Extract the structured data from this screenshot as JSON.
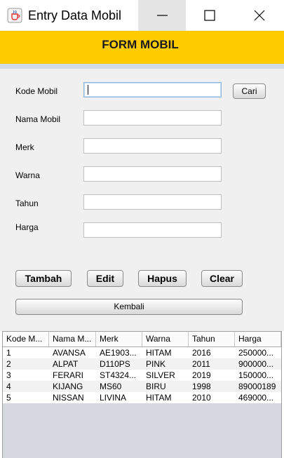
{
  "window": {
    "title": "Entry Data Mobil",
    "controls": {
      "minimize_icon": "minimize-icon",
      "maximize_icon": "maximize-icon",
      "close_icon": "close-icon"
    }
  },
  "banner": {
    "title": "FORM MOBIL",
    "color": "#ffcc00"
  },
  "form": {
    "fields": [
      {
        "label": "Kode Mobil",
        "value": ""
      },
      {
        "label": "Nama Mobil",
        "value": ""
      },
      {
        "label": "Merk",
        "value": ""
      },
      {
        "label": "Warna",
        "value": ""
      },
      {
        "label": "Tahun",
        "value": ""
      },
      {
        "label": "Harga",
        "value": ""
      }
    ],
    "search_button": "Cari"
  },
  "actions": {
    "tambah": "Tambah",
    "edit": "Edit",
    "hapus": "Hapus",
    "clear": "Clear",
    "kembali": "Kembali"
  },
  "table": {
    "columns": [
      "Kode M...",
      "Nama M...",
      "Merk",
      "Warna",
      "Tahun",
      "Harga"
    ],
    "rows": [
      [
        "1",
        "AVANSA",
        "AE1903...",
        "HITAM",
        "2016",
        "250000..."
      ],
      [
        "2",
        "ALPAT",
        "D110PS",
        "PINK",
        "2011",
        "900000..."
      ],
      [
        "3",
        "FERARI",
        "ST4324...",
        "SILVER",
        "2019",
        "150000..."
      ],
      [
        "4",
        "KIJANG",
        "MS60",
        "BIRU",
        "1998",
        "89000189"
      ],
      [
        "5",
        "NISSAN",
        "LIVINA",
        "HITAM",
        "2010",
        "469000..."
      ]
    ]
  }
}
